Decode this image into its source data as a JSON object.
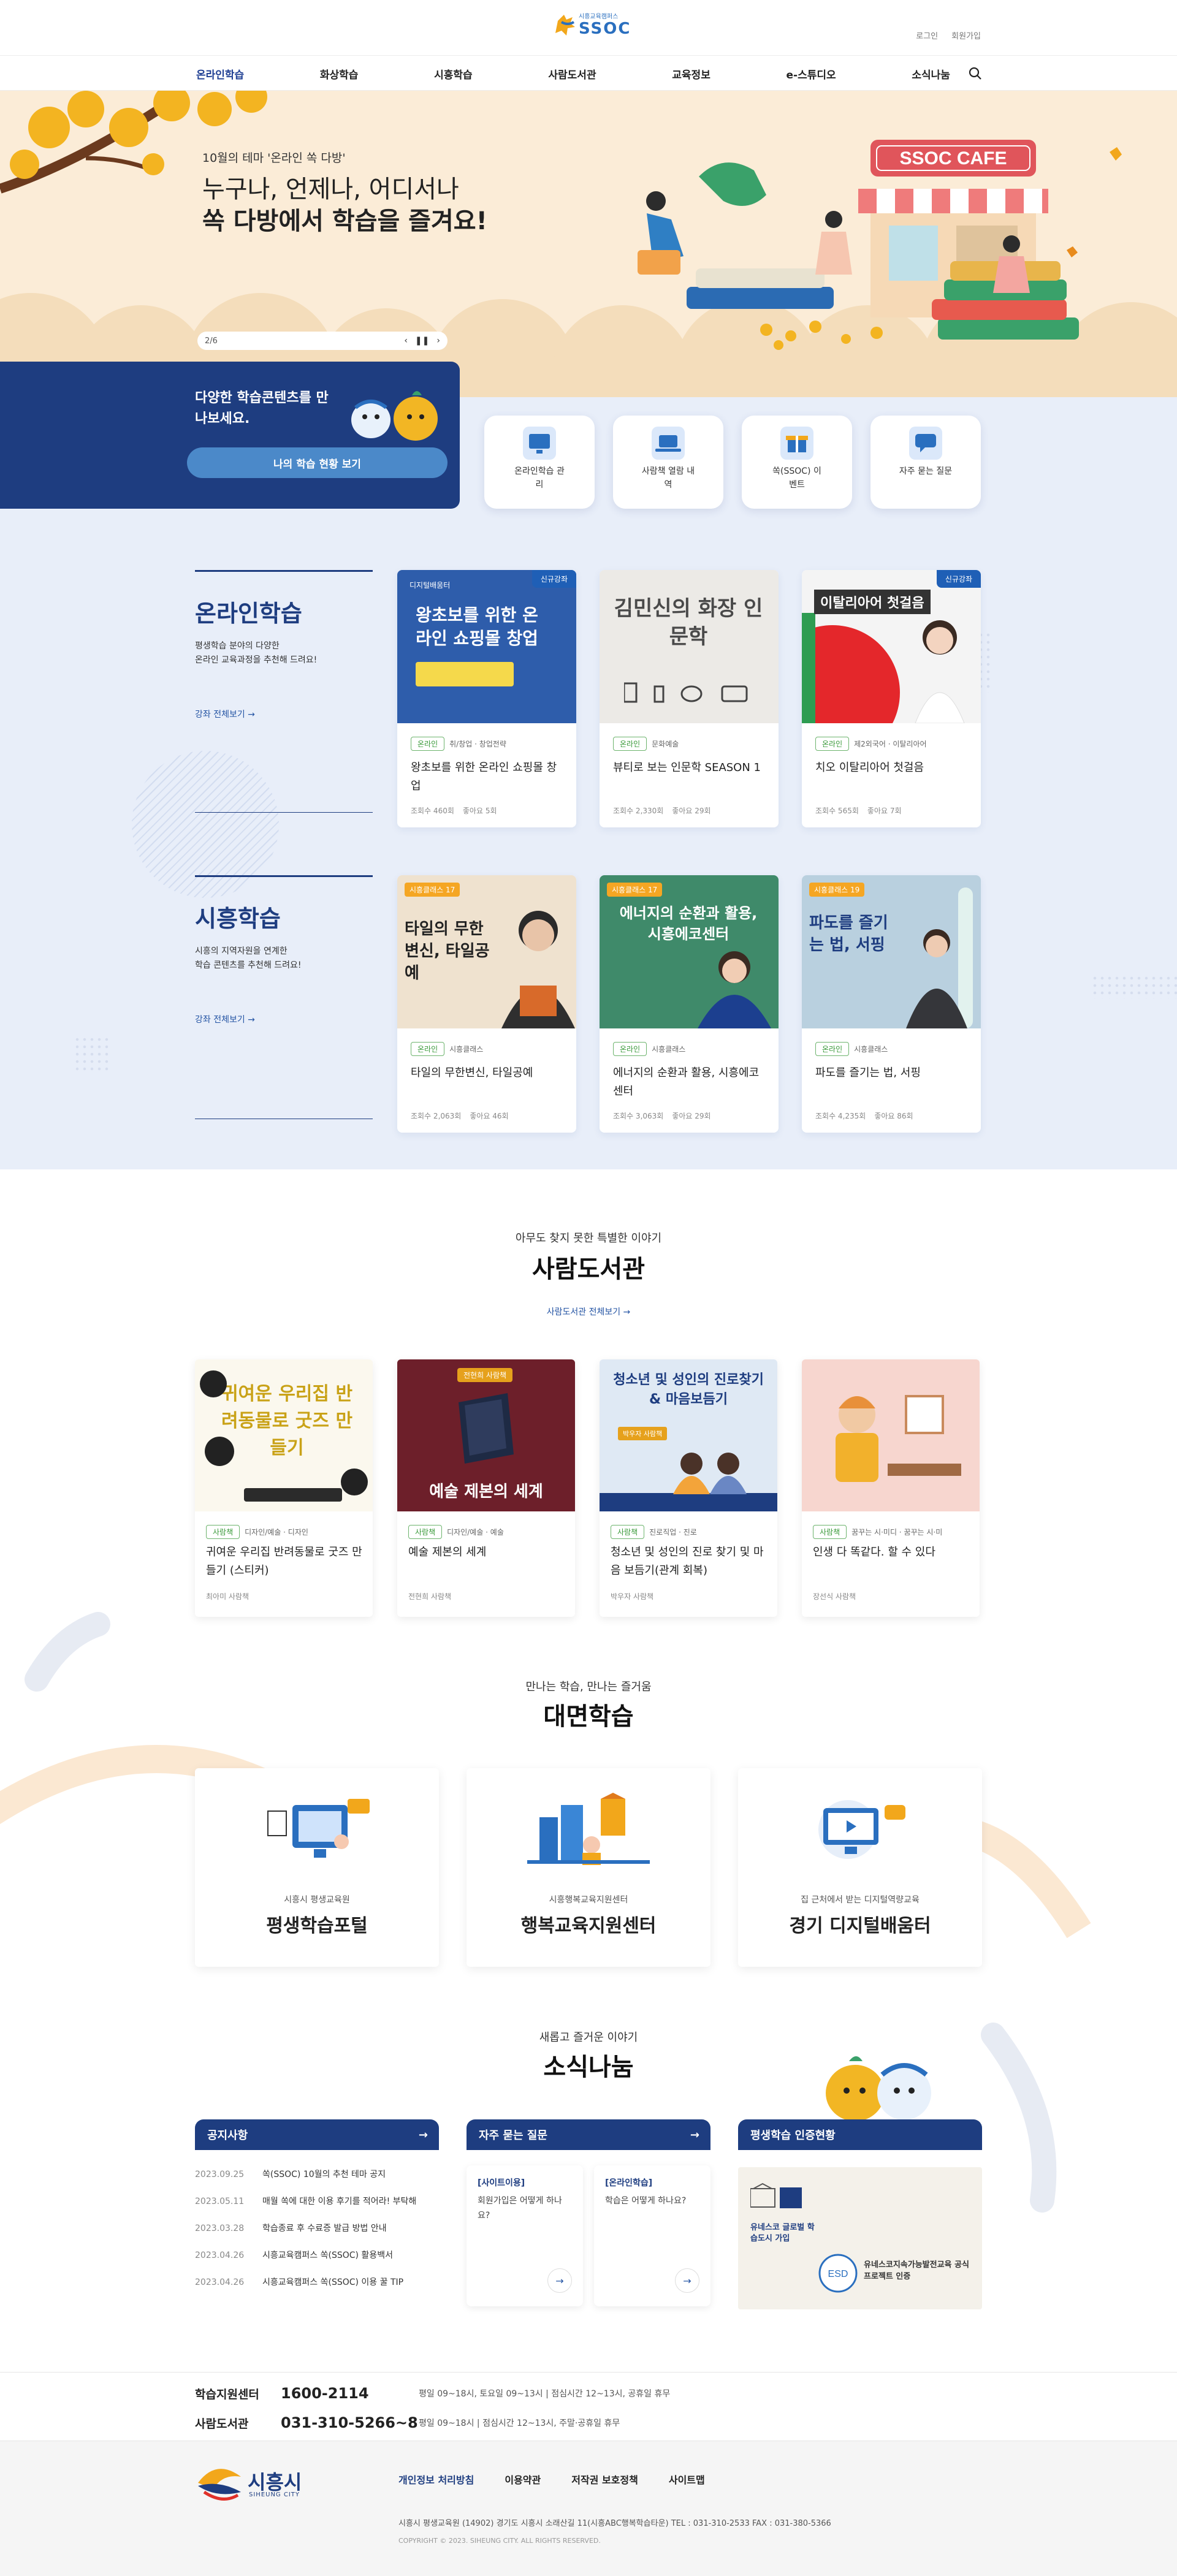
{
  "header": {
    "logo_text": "SSOC",
    "logo_small": "시흥교육캠퍼스",
    "util": [
      "로그인",
      "회원가입"
    ],
    "nav": [
      "온라인학습",
      "화상학습",
      "시흥학습",
      "사람도서관",
      "교육정보",
      "e-스튜디오",
      "소식나눔"
    ]
  },
  "hero": {
    "subtitle": "10월의 테마 '온라인 쏙 다방'",
    "line1": "누구나, 언제나, 어디서나",
    "line2": "쏙 다방에서 학습을 즐겨요!",
    "pager": "2/6",
    "cafe_sign": "SSOC CAFE"
  },
  "quick": {
    "title": "다양한 학습콘텐츠를 만나보세요.",
    "button": "나의 학습 현황 보기",
    "links": [
      {
        "label": "온라인학습 관리",
        "icon": "monitor-icon"
      },
      {
        "label": "사람책 열람 내역",
        "icon": "laptop-icon"
      },
      {
        "label": "쏙(SSOC) 이벤트",
        "icon": "gift-icon"
      },
      {
        "label": "자주 묻는 질문",
        "icon": "chat-icon"
      }
    ]
  },
  "online": {
    "title": "온라인학습",
    "desc": "평생학습 분야의 다양한\n온라인 교육과정을 추천해 드려요!",
    "more": "강좌 전체보기 →",
    "cards": [
      {
        "badge": "신규강좌",
        "tag": "온라인",
        "cat": "취/창업 · 창업전략",
        "title": "왕초보를 위한 온라인 쇼핑몰 창업",
        "views": "조회수 460회",
        "likes": "좋아요 5회",
        "thumb_text": "왕초보를 위한 온라인 쇼핑몰 창업",
        "thumb_small": "디지털배움터"
      },
      {
        "badge": "",
        "tag": "온라인",
        "cat": "문화예술",
        "title": "뷰티로 보는 인문학 SEASON 1",
        "views": "조회수 2,330회",
        "likes": "좋아요 29회",
        "thumb_text": "김민신의 화장 인문학"
      },
      {
        "badge": "신규강좌",
        "tag": "온라인",
        "cat": "제2외국어 · 이탈리아어",
        "title": "치오 이탈리아어 첫걸음",
        "views": "조회수 565회",
        "likes": "좋아요 7회",
        "thumb_text": "이탈리아어 첫걸음"
      }
    ]
  },
  "siheung": {
    "title": "시흥학습",
    "desc": "시흥의 지역자원을 연계한\n학습 콘텐츠를 추천해 드려요!",
    "more": "강좌 전체보기 →",
    "cards": [
      {
        "tag": "온라인",
        "cat": "시흥클래스",
        "title": "타일의 무한변신, 타일공예",
        "views": "조회수 2,063회",
        "likes": "좋아요 46회",
        "thumb_text": "타일의 무한 변신, 타일공예",
        "thumb_small": "시흥클래스 17"
      },
      {
        "tag": "온라인",
        "cat": "시흥클래스",
        "title": "에너지의 순환과 활용, 시흥에코센터",
        "views": "조회수 3,063회",
        "likes": "좋아요 29회",
        "thumb_text": "에너지의 순환과 활용, 시흥에코센터",
        "thumb_small": "시흥클래스 17"
      },
      {
        "tag": "온라인",
        "cat": "시흥클래스",
        "title": "파도를 즐기는 법, 서핑",
        "views": "조회수 4,235회",
        "likes": "좋아요 86회",
        "thumb_text": "파도를 즐기는 법, 서핑",
        "thumb_small": "시흥클래스 19"
      }
    ]
  },
  "library": {
    "sub": "아무도 찾지 못한 특별한 이야기",
    "title": "사람도서관",
    "more": "사람도서관 전체보기 →",
    "cards": [
      {
        "tag": "사람책",
        "cat": "디자인/예술 · 디자인",
        "title": "귀여운 우리집 반려동물로 굿즈 만들기 (스티커)",
        "author": "최아미 사람책",
        "thumb_text": "귀여운 우리집 반려동물로 굿즈 만들기"
      },
      {
        "tag": "사람책",
        "cat": "디자인/예술 · 예술",
        "title": "예술 제본의 세계",
        "author": "전현희 사람책",
        "thumb_text": "예술 제본의 세계",
        "thumb_small": "전현희 사람책"
      },
      {
        "tag": "사람책",
        "cat": "진로직업 · 진로",
        "title": "청소년 및 성인의 진로 찾기 및 마음 보듬기(관계 회복)",
        "author": "박우자 사람책",
        "thumb_text": "청소년 및 성인의 진로찾기 & 마음보듬기",
        "thumb_small": "박우자 사람책"
      },
      {
        "tag": "사람책",
        "cat": "꿈꾸는 시·미디 · 꿈꾸는 시·미",
        "title": "인생 다 똑같다. 할 수 있다",
        "author": "장선식 사람책"
      }
    ]
  },
  "offline": {
    "sub": "만나는 학습, 만나는 즐거움",
    "title": "대면학습",
    "cards": [
      {
        "sub": "시흥시 평생교육원",
        "title": "평생학습포털"
      },
      {
        "sub": "시흥행복교육지원센터",
        "title": "행복교육지원센터"
      },
      {
        "sub": "집 근처에서 받는 디지털역량교육",
        "title": "경기 디지털배움터"
      }
    ]
  },
  "news": {
    "sub": "새롭고 즐거운 이야기",
    "title": "소식나눔",
    "notice_title": "공지사항",
    "notices": [
      {
        "date": "2023.09.25",
        "text": "쏙(SSOC) 10월의 추천 테마 공지"
      },
      {
        "date": "2023.05.11",
        "text": "매월 쏙에 대한 이용 후기를 적어라! 부탁해"
      },
      {
        "date": "2023.03.28",
        "text": "학습종료 후 수료증 발급 방법 안내"
      },
      {
        "date": "2023.04.26",
        "text": "시흥교육캠퍼스 쏙(SSOC) 활용백서"
      },
      {
        "date": "2023.04.26",
        "text": "시흥교육캠퍼스 쏙(SSOC) 이용 꿀 TIP"
      }
    ],
    "faq_title": "자주 묻는 질문",
    "faqs": [
      {
        "cat": "[사이트이용]",
        "q": "회원가입은 어떻게 하나요?"
      },
      {
        "cat": "[온라인학습]",
        "q": "학습은 어떻게 하나요?"
      }
    ],
    "cert_title": "평생학습 인증현황",
    "cert_text": "유네스코 글로벌 학습도시 가입",
    "cert_text2": "유네스코지속가능발전교육 공식프로젝트 인증"
  },
  "contact": [
    {
      "name": "학습지원센터",
      "tel": "1600-2114",
      "hours": "평일 09~18시, 토요일 09~13시  |  점심시간 12~13시, 공휴일 휴무"
    },
    {
      "name": "사람도서관",
      "tel": "031-310-5266~8",
      "hours": "평일 09~18시  |  점심시간 12~13시, 주말·공휴일 휴무"
    }
  ],
  "footer": {
    "logo": "시흥시",
    "logo_en": "SIHEUNG CITY",
    "links": [
      "개인정보 처리방침",
      "이용약관",
      "저작권 보호정책",
      "사이트맵"
    ],
    "address": "시흥시 평생교육원   (14902) 경기도 시흥시 소래산길 11(시흥ABC행복학습타운)   TEL : 031-310-2533   FAX : 031-380-5366",
    "copy": "COPYRIGHT © 2023. SIHEUNG CITY. ALL RIGHTS RESERVED."
  },
  "colors": {
    "primary": "#1e3d80",
    "accent": "#2454a4",
    "hero_bg": "#fbecd7",
    "panel_bg": "#e8eef9",
    "tag_green": "#3a9a3a"
  }
}
